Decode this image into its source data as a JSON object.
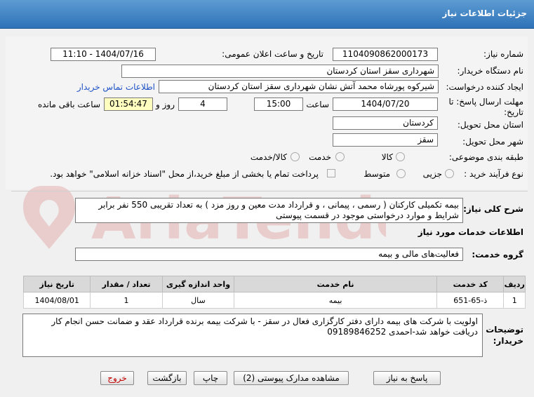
{
  "header": {
    "title": "جزئیات اطلاعات نیاز"
  },
  "form": {
    "need_number_label": "شماره نیاز:",
    "need_number": "1104090862000173",
    "announce_label": "تاریخ و ساعت اعلان عمومی:",
    "announce_value": "1404/07/16 - 11:10",
    "buyer_org_label": "نام دستگاه خریدار:",
    "buyer_org": "شهرداری سقز استان کردستان",
    "creator_label": "ایجاد کننده درخواست:",
    "creator": "شیرکوه پورشاه محمد آتش نشان شهرداری سقز استان کردستان",
    "contact_link": "اطلاعات تماس خریدار",
    "deadline_label_1": "مهلت ارسال پاسخ: تا",
    "deadline_label_2": "تاریخ:",
    "deadline_date": "1404/07/20",
    "time_label": "ساعت",
    "deadline_time": "15:00",
    "days_value": "4",
    "days_label": "روز و",
    "remaining_time": "01:54:47",
    "remaining_label": "ساعت باقی مانده",
    "province_label": "استان محل تحویل:",
    "province": "کردستان",
    "city_label": "شهر محل تحویل:",
    "city": "سقز",
    "category_label": "طبقه بندی موضوعی:",
    "category_options": [
      "کالا/خدمت",
      "خدمت",
      "کالا"
    ],
    "process_label": "نوع فرآیند خرید :",
    "process_options": [
      "جزیی",
      "متوسط"
    ],
    "payment_text": "پرداخت تمام یا بخشی از مبلغ خرید،از محل \"اسناد خزانه اسلامی\" خواهد بود."
  },
  "summary": {
    "label": "شرح کلی نیاز:",
    "text": "بیمه تکمیلی کارکنان ( رسمی ، پیمانی ، و قرارداد مدت معین و روز مزد ) به تعداد تقریبی 550 نفر برابر شرایط و موارد درخواستی موجود در قسمت پیوستی"
  },
  "services": {
    "section_title": "اطلاعات خدمات مورد نیاز",
    "group_label": "گروه خدمت:",
    "group_value": "فعالیت‌های مالی و بیمه",
    "columns": [
      "ردیف",
      "کد خدمت",
      "نام خدمت",
      "واحد اندازه گیری",
      "تعداد / مقدار",
      "تاریخ نیاز"
    ],
    "rows": [
      [
        "1",
        "ذ-65-651",
        "بیمه",
        "سال",
        "1",
        "1404/08/01"
      ]
    ]
  },
  "notes": {
    "label_1": "توضیحات",
    "label_2": "خریدار:",
    "text": "اولویت با شرکت های بیمه دارای دفتر کارگزاری فعال در سقز - با شرکت بیمه برنده قرارداد عقد و ضمانت حسن انجام کار دریافت خواهد شد-احمدی 09189846252"
  },
  "buttons": {
    "reply": "پاسخ به نیاز",
    "attachments": "مشاهده مدارک پیوستی (2)",
    "print": "چاپ",
    "back": "بازگشت",
    "exit": "خروج"
  },
  "watermark": {
    "text": "AriaTender.net"
  },
  "colors": {
    "title_bar": "#2e72b8",
    "exit_text": "#c00000",
    "link": "#1f52c7"
  }
}
